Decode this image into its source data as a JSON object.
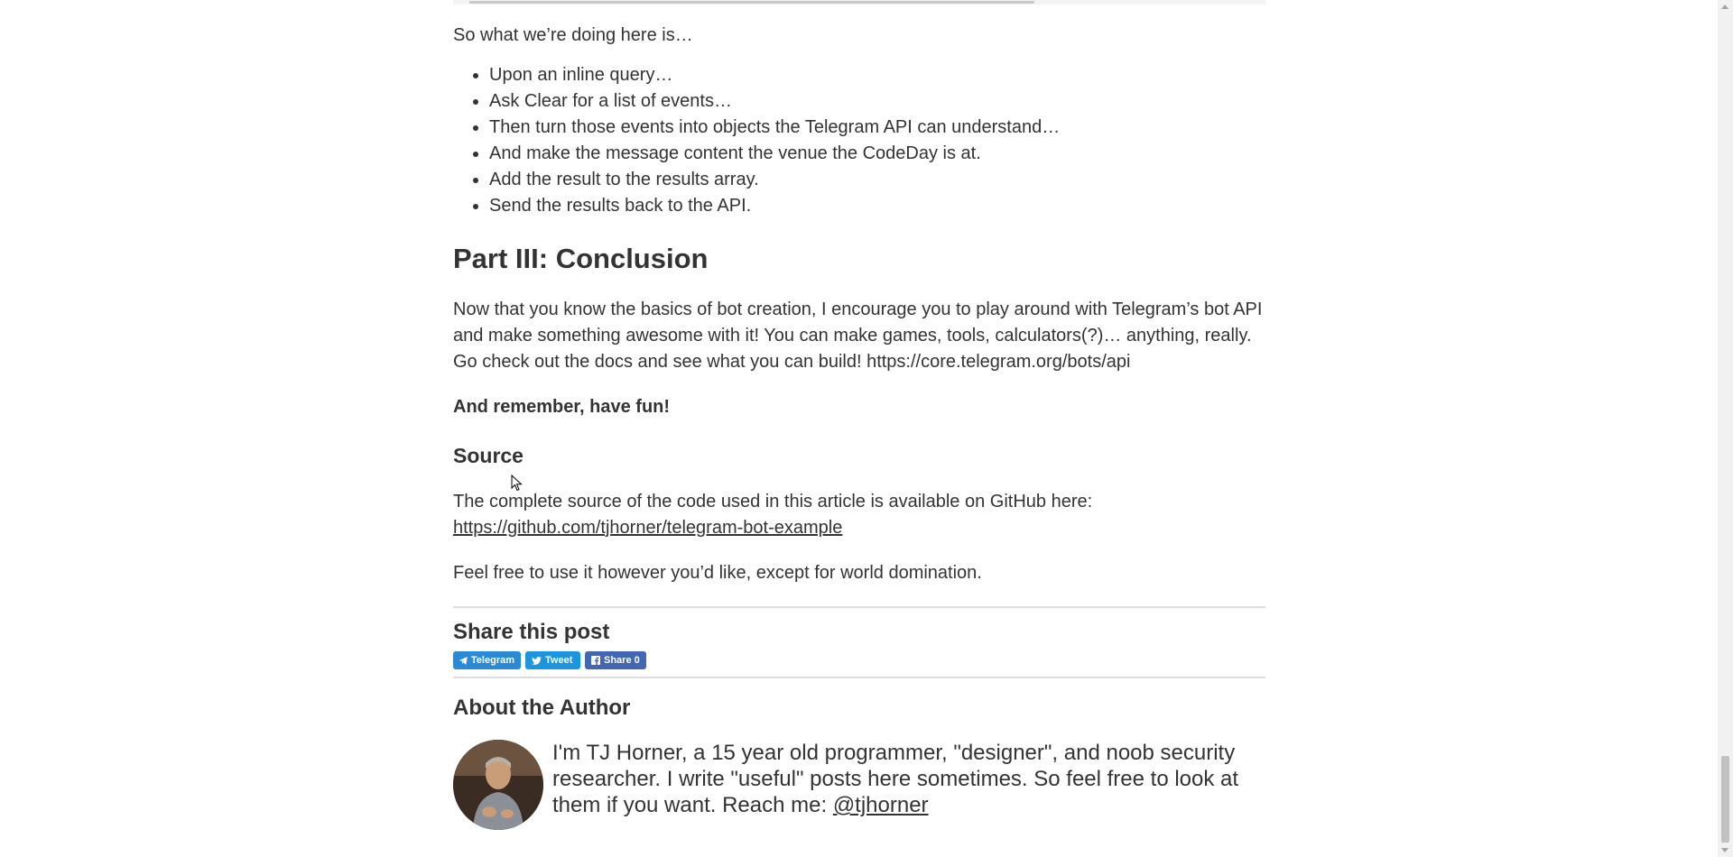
{
  "intro": "So what we’re doing here is…",
  "steps": [
    "Upon an inline query…",
    "Ask Clear for a list of events…",
    "Then turn those events into objects the Telegram API can understand…",
    "And make the message content the venue the CodeDay is at.",
    "Add the result to the results array.",
    "Send the results back to the API."
  ],
  "conclusion": {
    "heading": "Part III: Conclusion",
    "paragraph": "Now that you know the basics of bot creation, I encourage you to play around with Telegram’s bot API and make something awesome with it! You can make games, tools, calculators(?)… anything, really. Go check out the docs and see what you can build! https://core.telegram.org/bots/api",
    "remember": "And remember, have fun!"
  },
  "source": {
    "heading": "Source",
    "text": "The complete source of the code used in this article is available on GitHub here:",
    "link": "https://github.com/tjhorner/telegram-bot-example",
    "note": "Feel free to use it however you’d like, except for world domination."
  },
  "share": {
    "title": "Share this post",
    "buttons": {
      "telegram": "Telegram",
      "tweet": "Tweet",
      "facebook": "Share 0"
    },
    "colors": {
      "telegram": "#2a8ad6",
      "tweet": "#1b95e0",
      "facebook": "#4267b2"
    }
  },
  "author": {
    "title": "About the Author",
    "bio": "I'm TJ Horner, a 15 year old programmer, \"designer\", and noob security researcher. I write \"useful\" posts here sometimes. So feel free to look at them if you want. Reach me: ",
    "handle": "@tjhorner"
  }
}
